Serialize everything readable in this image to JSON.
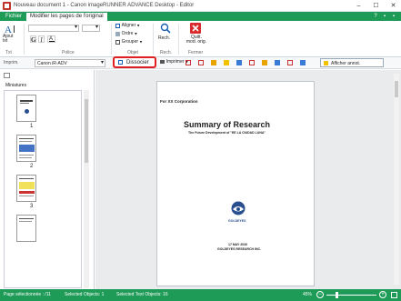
{
  "window": {
    "title": "Nouveau document 1 - Canon imageRUNNER ADVANCE Desktop - Editor",
    "controls": [
      "–",
      "☐",
      "✕"
    ]
  },
  "tabs": {
    "file": "Fichier",
    "edit": "Modifier les pages de l'original",
    "right_icons": [
      "?",
      "▪",
      "▪"
    ]
  },
  "ribbon": {
    "add_text": "Ajout\ntxt",
    "group_texte": "Txt",
    "group_police": "Police",
    "aligner": "Aligner",
    "ordre": "Ordre",
    "grouper": "Grouper",
    "dissocier": "Dissocier",
    "group_objet": "Objet",
    "rech": "Rech.",
    "group_rech": "Rech.",
    "quitter": "Quitt.\nmod. orig.",
    "group_fermer": "Fermer"
  },
  "cmdbar": {
    "printer_label": "Imprim.",
    "printer_value": "Canon iR-ADV",
    "imprimer": "Imprimer",
    "afficher_annot": "Afficher annot."
  },
  "thumbnails": {
    "header": "Miniatures",
    "pages": [
      "1",
      "2",
      "3"
    ]
  },
  "document": {
    "company": "For XX Corporation",
    "title": "Summary of Research",
    "subtitle": "The Future Development of \"EE LA CIUDAD LUNA\"",
    "logo_text": "GOLDEYES",
    "date": "17 MAY 2030",
    "org": "GOLDEYES RESEARCH INC."
  },
  "status": {
    "pages_selected": "Page sélectionnée : /11",
    "selected_objects": "Selected Objects: 1",
    "selected_text_objects": "Selected Text Objects: 16",
    "zoom": "45%"
  },
  "colors": {
    "accent": "#1e9b57",
    "highlight": "#e02020"
  }
}
